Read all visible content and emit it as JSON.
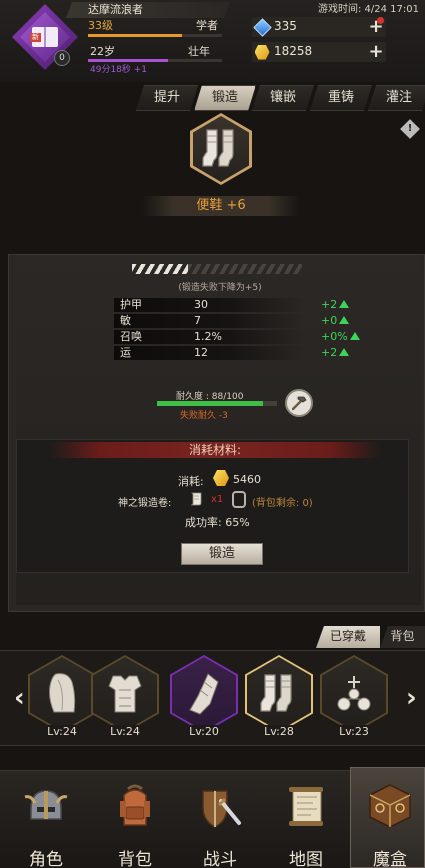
{
  "header": {
    "avatar_badge": "新",
    "avatar_level": "0",
    "name": "达摩流浪者",
    "level": "33级",
    "title": "学者",
    "age": "22岁",
    "age_stage": "壮年",
    "age_timer": "49分18秒 +1",
    "game_time": "游戏时间: 4/24 17:01",
    "gems": "335",
    "gold": "18258"
  },
  "tabs": [
    {
      "label": "提升",
      "active": false
    },
    {
      "label": "锻造",
      "active": true
    },
    {
      "label": "镶嵌",
      "active": false
    },
    {
      "label": "重铸",
      "active": false
    },
    {
      "label": "灌注",
      "active": false
    }
  ],
  "item": {
    "name": "便鞋 +6",
    "icon": "boots-icon"
  },
  "forge": {
    "warning": "(锻造失败下降为+5)",
    "stats": [
      {
        "name": "护甲",
        "value": "30",
        "increase": "+2"
      },
      {
        "name": "敏",
        "value": "7",
        "increase": "+0"
      },
      {
        "name": "召唤",
        "value": "1.2%",
        "increase": "+0%"
      },
      {
        "name": "运",
        "value": "12",
        "increase": "+2"
      }
    ],
    "durability": "耐久度 : 88/100",
    "durability_fill": 0.88,
    "fail_durability": "失败耐久 -3",
    "materials_title": "消耗材料:",
    "cost_label": "消耗:",
    "cost_value": "5460",
    "scroll_label": "神之锻造卷:",
    "scroll_count": "x1",
    "scroll_remain": "(背包剩余: 0)",
    "success_rate": "成功率: 65%",
    "forge_button": "锻造"
  },
  "equipment": {
    "tab_worn": "已穿戴",
    "tab_bag": "背包",
    "arrow_left": "‹",
    "arrow_right": "›",
    "items": [
      {
        "icon": "cloak-icon",
        "level": "Lv:24",
        "rarity": "common"
      },
      {
        "icon": "armor-icon",
        "level": "Lv:24",
        "rarity": "common"
      },
      {
        "icon": "gauntlet-icon",
        "level": "Lv:20",
        "rarity": "purple"
      },
      {
        "icon": "boots-icon",
        "level": "Lv:28",
        "rarity": "selected"
      },
      {
        "icon": "amulet-icon",
        "level": "Lv:23",
        "rarity": "common"
      }
    ]
  },
  "nav": [
    {
      "label": "角色",
      "icon": "helmet-icon"
    },
    {
      "label": "背包",
      "icon": "backpack-icon"
    },
    {
      "label": "战斗",
      "icon": "sword-shield-icon"
    },
    {
      "label": "地图",
      "icon": "map-scroll-icon"
    },
    {
      "label": "魔盒",
      "icon": "magic-box-icon",
      "active": true
    }
  ],
  "colors": {
    "accent_gold": "#e8a03a",
    "positive": "#3ed45a",
    "negative": "#c8352d",
    "purple": "#a652d3"
  }
}
